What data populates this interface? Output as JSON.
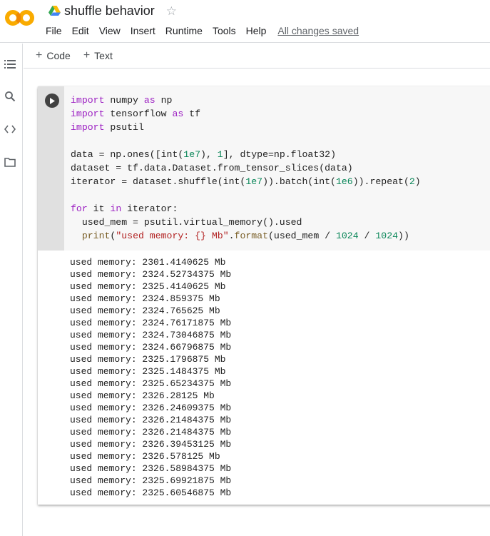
{
  "header": {
    "title": "shuffle behavior",
    "menu": [
      "File",
      "Edit",
      "View",
      "Insert",
      "Runtime",
      "Tools",
      "Help"
    ],
    "save_status": "All changes saved",
    "logo_text": "CO",
    "brand_color": "#f9ab00"
  },
  "rail": {
    "items": [
      {
        "icon": "table-of-contents-icon"
      },
      {
        "icon": "search-icon"
      },
      {
        "icon": "code-snippets-icon"
      },
      {
        "icon": "files-folder-icon"
      }
    ]
  },
  "toolbar": {
    "add_code_label": "Code",
    "add_text_label": "Text"
  },
  "cell": {
    "code_lines": [
      [
        {
          "t": "import",
          "c": "kw"
        },
        {
          "t": " numpy "
        },
        {
          "t": "as",
          "c": "kw"
        },
        {
          "t": " np"
        }
      ],
      [
        {
          "t": "import",
          "c": "kw"
        },
        {
          "t": " tensorflow "
        },
        {
          "t": "as",
          "c": "kw"
        },
        {
          "t": " tf"
        }
      ],
      [
        {
          "t": "import",
          "c": "kw"
        },
        {
          "t": " psutil"
        }
      ],
      [],
      [
        {
          "t": "data = np.ones([int("
        },
        {
          "t": "1e7",
          "c": "num"
        },
        {
          "t": "), "
        },
        {
          "t": "1",
          "c": "num"
        },
        {
          "t": "], dtype=np.float32)"
        }
      ],
      [
        {
          "t": "dataset = tf.data.Dataset.from_tensor_slices(data)"
        }
      ],
      [
        {
          "t": "iterator = dataset.shuffle(int("
        },
        {
          "t": "1e7",
          "c": "num"
        },
        {
          "t": ")).batch(int("
        },
        {
          "t": "1e6",
          "c": "num"
        },
        {
          "t": ")).repeat("
        },
        {
          "t": "2",
          "c": "num"
        },
        {
          "t": ")"
        }
      ],
      [],
      [
        {
          "t": "for",
          "c": "kw"
        },
        {
          "t": " it "
        },
        {
          "t": "in",
          "c": "kw"
        },
        {
          "t": " iterator:"
        }
      ],
      [
        {
          "t": "  used_mem = psutil.virtual_memory().used"
        }
      ],
      [
        {
          "t": "  "
        },
        {
          "t": "print",
          "c": "bi"
        },
        {
          "t": "("
        },
        {
          "t": "\"used memory: {} Mb\"",
          "c": "str"
        },
        {
          "t": "."
        },
        {
          "t": "format",
          "c": "bi"
        },
        {
          "t": "(used_mem / "
        },
        {
          "t": "1024",
          "c": "num"
        },
        {
          "t": " / "
        },
        {
          "t": "1024",
          "c": "num"
        },
        {
          "t": "))"
        }
      ]
    ],
    "output_lines": [
      "used memory: 2301.4140625 Mb",
      "used memory: 2324.52734375 Mb",
      "used memory: 2325.4140625 Mb",
      "used memory: 2324.859375 Mb",
      "used memory: 2324.765625 Mb",
      "used memory: 2324.76171875 Mb",
      "used memory: 2324.73046875 Mb",
      "used memory: 2324.66796875 Mb",
      "used memory: 2325.1796875 Mb",
      "used memory: 2325.1484375 Mb",
      "used memory: 2325.65234375 Mb",
      "used memory: 2326.28125 Mb",
      "used memory: 2326.24609375 Mb",
      "used memory: 2326.21484375 Mb",
      "used memory: 2326.21484375 Mb",
      "used memory: 2326.39453125 Mb",
      "used memory: 2326.578125 Mb",
      "used memory: 2326.58984375 Mb",
      "used memory: 2325.69921875 Mb",
      "used memory: 2325.60546875 Mb"
    ]
  }
}
